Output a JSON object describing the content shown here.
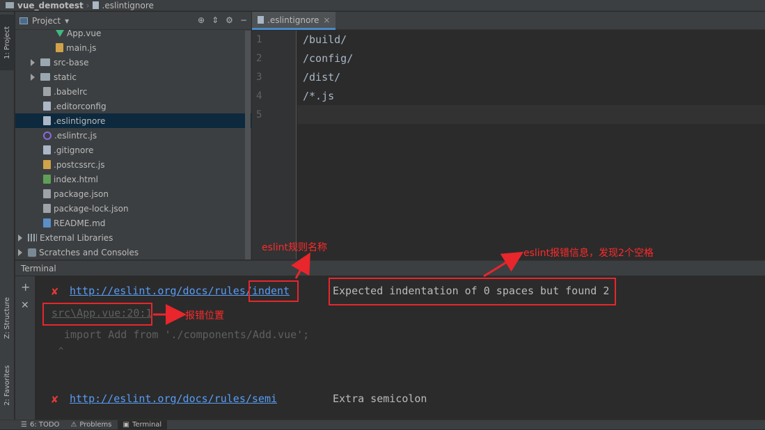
{
  "breadcrumb": {
    "project": "vue_demotest",
    "file": ".eslintignore"
  },
  "left_strip": {
    "project_tab": "1: Project",
    "structure_tab": "Z: Structure",
    "favorites_tab": "2: Favorites"
  },
  "project_panel": {
    "title": "Project",
    "items": [
      {
        "label": "App.vue",
        "icon": "vue-icon"
      },
      {
        "label": "main.js",
        "icon": "js-icon"
      },
      {
        "label": "src-base",
        "icon": "folder-icon"
      },
      {
        "label": "static",
        "icon": "folder-icon"
      },
      {
        "label": ".babelrc",
        "icon": "config-icon"
      },
      {
        "label": ".editorconfig",
        "icon": "file-icon"
      },
      {
        "label": ".eslintignore",
        "icon": "file-icon"
      },
      {
        "label": ".eslintrc.js",
        "icon": "eslint-icon"
      },
      {
        "label": ".gitignore",
        "icon": "file-icon"
      },
      {
        "label": ".postcssrc.js",
        "icon": "js-icon"
      },
      {
        "label": "index.html",
        "icon": "html-icon"
      },
      {
        "label": "package.json",
        "icon": "json-icon"
      },
      {
        "label": "package-lock.json",
        "icon": "json-icon"
      },
      {
        "label": "README.md",
        "icon": "md-icon"
      },
      {
        "label": "External Libraries",
        "icon": "library-icon"
      },
      {
        "label": "Scratches and Consoles",
        "icon": "scratch-icon"
      }
    ]
  },
  "editor": {
    "tab_label": ".eslintignore",
    "line_numbers": [
      "1",
      "2",
      "3",
      "4",
      "5"
    ],
    "lines": [
      "/build/",
      "/config/",
      "/dist/",
      "/*.js",
      ""
    ]
  },
  "terminal": {
    "title": "Terminal",
    "error1_link": "http://eslint.org/docs/rules/indent",
    "error1_message": "Expected indentation of 0 spaces but found 2",
    "error1_location": "src\\App.vue:20:1",
    "error1_code": "import Add from './components/Add.vue';",
    "error1_caret": "^",
    "error2_link": "http://eslint.org/docs/rules/semi",
    "error2_message": "Extra semicolon",
    "error_mark": "✘"
  },
  "annotations": {
    "rule_name": "eslint规则名称",
    "error_info": "eslint报错信息，发现2个空格",
    "error_position": "报错位置"
  },
  "bottom_bar": {
    "todo": "6: TODO",
    "problems": "Problems",
    "terminal": "Terminal"
  },
  "colors": {
    "annotation_red": "#e8262c",
    "link_blue": "#589df6",
    "selection": "#0d293e",
    "accent_tab": "#4a88c7"
  }
}
